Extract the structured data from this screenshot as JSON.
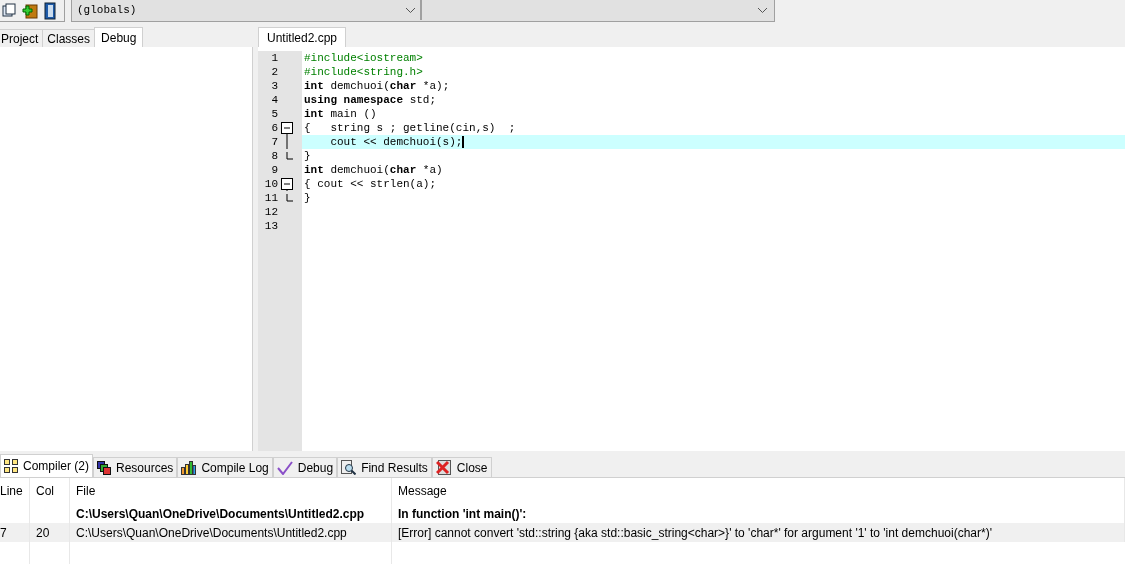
{
  "toolbar": {
    "scope_dropdown": "(globals)"
  },
  "left_tabs": [
    {
      "label": "Project",
      "selected": false
    },
    {
      "label": "Classes",
      "selected": false
    },
    {
      "label": "Debug",
      "selected": true
    }
  ],
  "editor": {
    "tab": "Untitled2.cpp",
    "lines": [
      {
        "number": "1",
        "kind": "plain",
        "selected": false,
        "segments": [
          {
            "kind": "preprocessor",
            "text": "#include<iostream>"
          }
        ]
      },
      {
        "number": "2",
        "kind": "plain",
        "selected": false,
        "segments": [
          {
            "kind": "preprocessor",
            "text": "#include<string.h>"
          }
        ]
      },
      {
        "number": "3",
        "kind": "plain",
        "selected": false,
        "segments": [
          {
            "kind": "keyword",
            "text": "int"
          },
          {
            "kind": "plain",
            "text": " demchuoi("
          },
          {
            "kind": "keyword",
            "text": "char"
          },
          {
            "kind": "plain",
            "text": " *a);"
          }
        ]
      },
      {
        "number": "4",
        "kind": "plain",
        "selected": false,
        "segments": [
          {
            "kind": "keyword",
            "text": "using namespace"
          },
          {
            "kind": "plain",
            "text": " std;"
          }
        ]
      },
      {
        "number": "5",
        "kind": "plain",
        "selected": false,
        "segments": [
          {
            "kind": "keyword",
            "text": "int"
          },
          {
            "kind": "plain",
            "text": " main ()"
          }
        ]
      },
      {
        "number": "6",
        "kind": "foldstart",
        "selected": false,
        "segments": [
          {
            "kind": "plain",
            "text": "{   string s ; getline(cin,s)  ;"
          }
        ]
      },
      {
        "number": "7",
        "kind": "foldline",
        "selected": true,
        "segments": [
          {
            "kind": "plain",
            "text": "    cout << demchuoi(s);"
          }
        ]
      },
      {
        "number": "8",
        "kind": "foldend",
        "selected": false,
        "segments": [
          {
            "kind": "plain",
            "text": "}"
          }
        ]
      },
      {
        "number": "9",
        "kind": "plain",
        "selected": false,
        "segments": [
          {
            "kind": "keyword",
            "text": "int"
          },
          {
            "kind": "plain",
            "text": " demchuoi("
          },
          {
            "kind": "keyword",
            "text": "char"
          },
          {
            "kind": "plain",
            "text": " *a)"
          }
        ]
      },
      {
        "number": "10",
        "kind": "foldstart",
        "selected": false,
        "segments": [
          {
            "kind": "plain",
            "text": "{ cout << strlen(a);"
          }
        ]
      },
      {
        "number": "11",
        "kind": "foldend",
        "selected": false,
        "segments": [
          {
            "kind": "plain",
            "text": "}"
          }
        ]
      },
      {
        "number": "12",
        "kind": "plain",
        "selected": false
      },
      {
        "number": "13",
        "kind": "plain",
        "selected": false
      }
    ]
  },
  "bottom_tabs": [
    {
      "label": "Compiler (2)",
      "selected": true
    },
    {
      "label": "Resources",
      "selected": false
    },
    {
      "label": "Compile Log",
      "selected": false
    },
    {
      "label": "Debug",
      "selected": false
    },
    {
      "label": "Find Results",
      "selected": false
    },
    {
      "label": "Close",
      "selected": false
    }
  ],
  "messages": {
    "columns": [
      "Line",
      "Col",
      "File",
      "Message"
    ],
    "rows": [
      {
        "kind": "header",
        "selected": false,
        "line": "",
        "col": "",
        "file": "C:\\Users\\Quan\\OneDrive\\Documents\\Untitled2.cpp",
        "message": "In function 'int main()':"
      },
      {
        "kind": "error",
        "selected": true,
        "line": "7",
        "col": "20",
        "file": "C:\\Users\\Quan\\OneDrive\\Documents\\Untitled2.cpp",
        "message": "[Error] cannot convert 'std::string {aka std::basic_string<char>}' to 'char*' for argument '1' to 'int demchuoi(char*)'"
      }
    ]
  }
}
